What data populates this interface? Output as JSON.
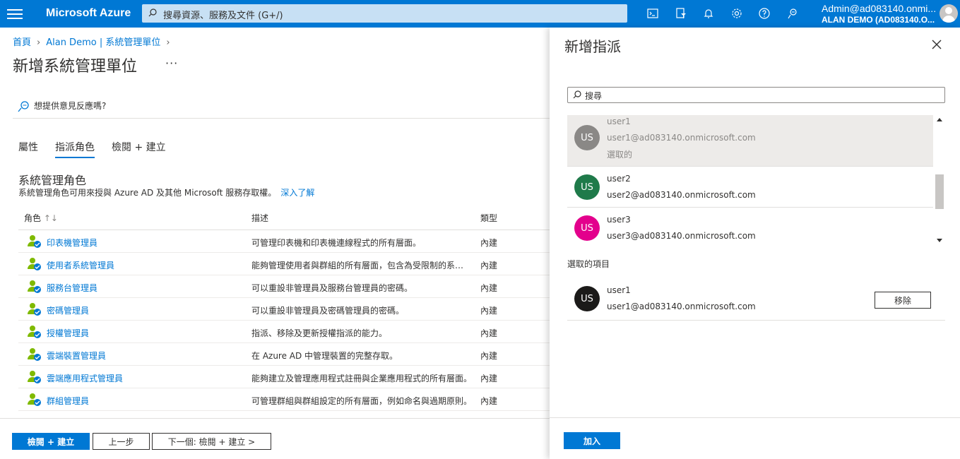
{
  "topbar": {
    "brand": "Microsoft Azure",
    "search_placeholder": "搜尋資源、服務及文件 (G+/)",
    "account_name": "Admin@ad083140.onmi...",
    "tenant": "ALAN DEMO (AD083140.O...",
    "icons": [
      "cloud-shell-icon",
      "directory-filter-icon",
      "bell-icon",
      "gear-icon",
      "help-icon",
      "feedback-icon"
    ]
  },
  "breadcrumb": {
    "home": "首頁",
    "parent": "Alan Demo | 系統管理單位"
  },
  "page": {
    "title": "新增系統管理單位",
    "more": "···"
  },
  "feedback": "想提供意見反應嗎?",
  "tabs": [
    "屬性",
    "指派角色",
    "檢閱 + 建立"
  ],
  "active_tab": 1,
  "section": {
    "title": "系統管理角色",
    "subtitle": "系統管理角色可用來授與 Azure AD 及其他 Microsoft 服務存取權。",
    "link": "深入了解"
  },
  "table": {
    "headers": {
      "role": "角色",
      "sort": "↑↓",
      "desc": "描述",
      "type": "類型"
    },
    "rows": [
      {
        "name": "印表機管理員",
        "desc": "可管理印表機和印表機連線程式的所有層面。",
        "type": "內建"
      },
      {
        "name": "使用者系統管理員",
        "desc": "能夠管理使用者與群組的所有層面，包含為受限制的系統管理員重設密碼。",
        "type": "內建"
      },
      {
        "name": "服務台管理員",
        "desc": "可以重設非管理員及服務台管理員的密碼。",
        "type": "內建"
      },
      {
        "name": "密碼管理員",
        "desc": "可以重設非管理員及密碼管理員的密碼。",
        "type": "內建"
      },
      {
        "name": "授權管理員",
        "desc": "指派、移除及更新授權指派的能力。",
        "type": "內建"
      },
      {
        "name": "雲端裝置管理員",
        "desc": "在 Azure AD 中管理裝置的完整存取。",
        "type": "內建"
      },
      {
        "name": "雲端應用程式管理員",
        "desc": "能夠建立及管理應用程式註冊與企業應用程式的所有層面。",
        "type": "內建"
      },
      {
        "name": "群組管理員",
        "desc": "可管理群組與群組設定的所有層面，例如命名與過期原則。",
        "type": "內建"
      }
    ]
  },
  "footer": {
    "review": "檢閱 + 建立",
    "prev": "上一步",
    "next": "下一個: 檢閱 + 建立 >"
  },
  "panel": {
    "title": "新增指派",
    "search_placeholder": "搜尋",
    "users": [
      {
        "initials": "US",
        "name": "user1",
        "email": "user1@ad083140.onmicrosoft.com",
        "state": "選取的",
        "color": "#8a8886"
      },
      {
        "initials": "US",
        "name": "user2",
        "email": "user2@ad083140.onmicrosoft.com",
        "state": "",
        "color": "#1f7a4a"
      },
      {
        "initials": "US",
        "name": "user3",
        "email": "user3@ad083140.onmicrosoft.com",
        "state": "",
        "color": "#e3008c"
      }
    ],
    "selected_header": "選取的項目",
    "selected": {
      "initials": "US",
      "name": "user1",
      "email": "user1@ad083140.onmicrosoft.com",
      "color": "#1b1a19",
      "remove": "移除"
    },
    "add_button": "加入"
  }
}
